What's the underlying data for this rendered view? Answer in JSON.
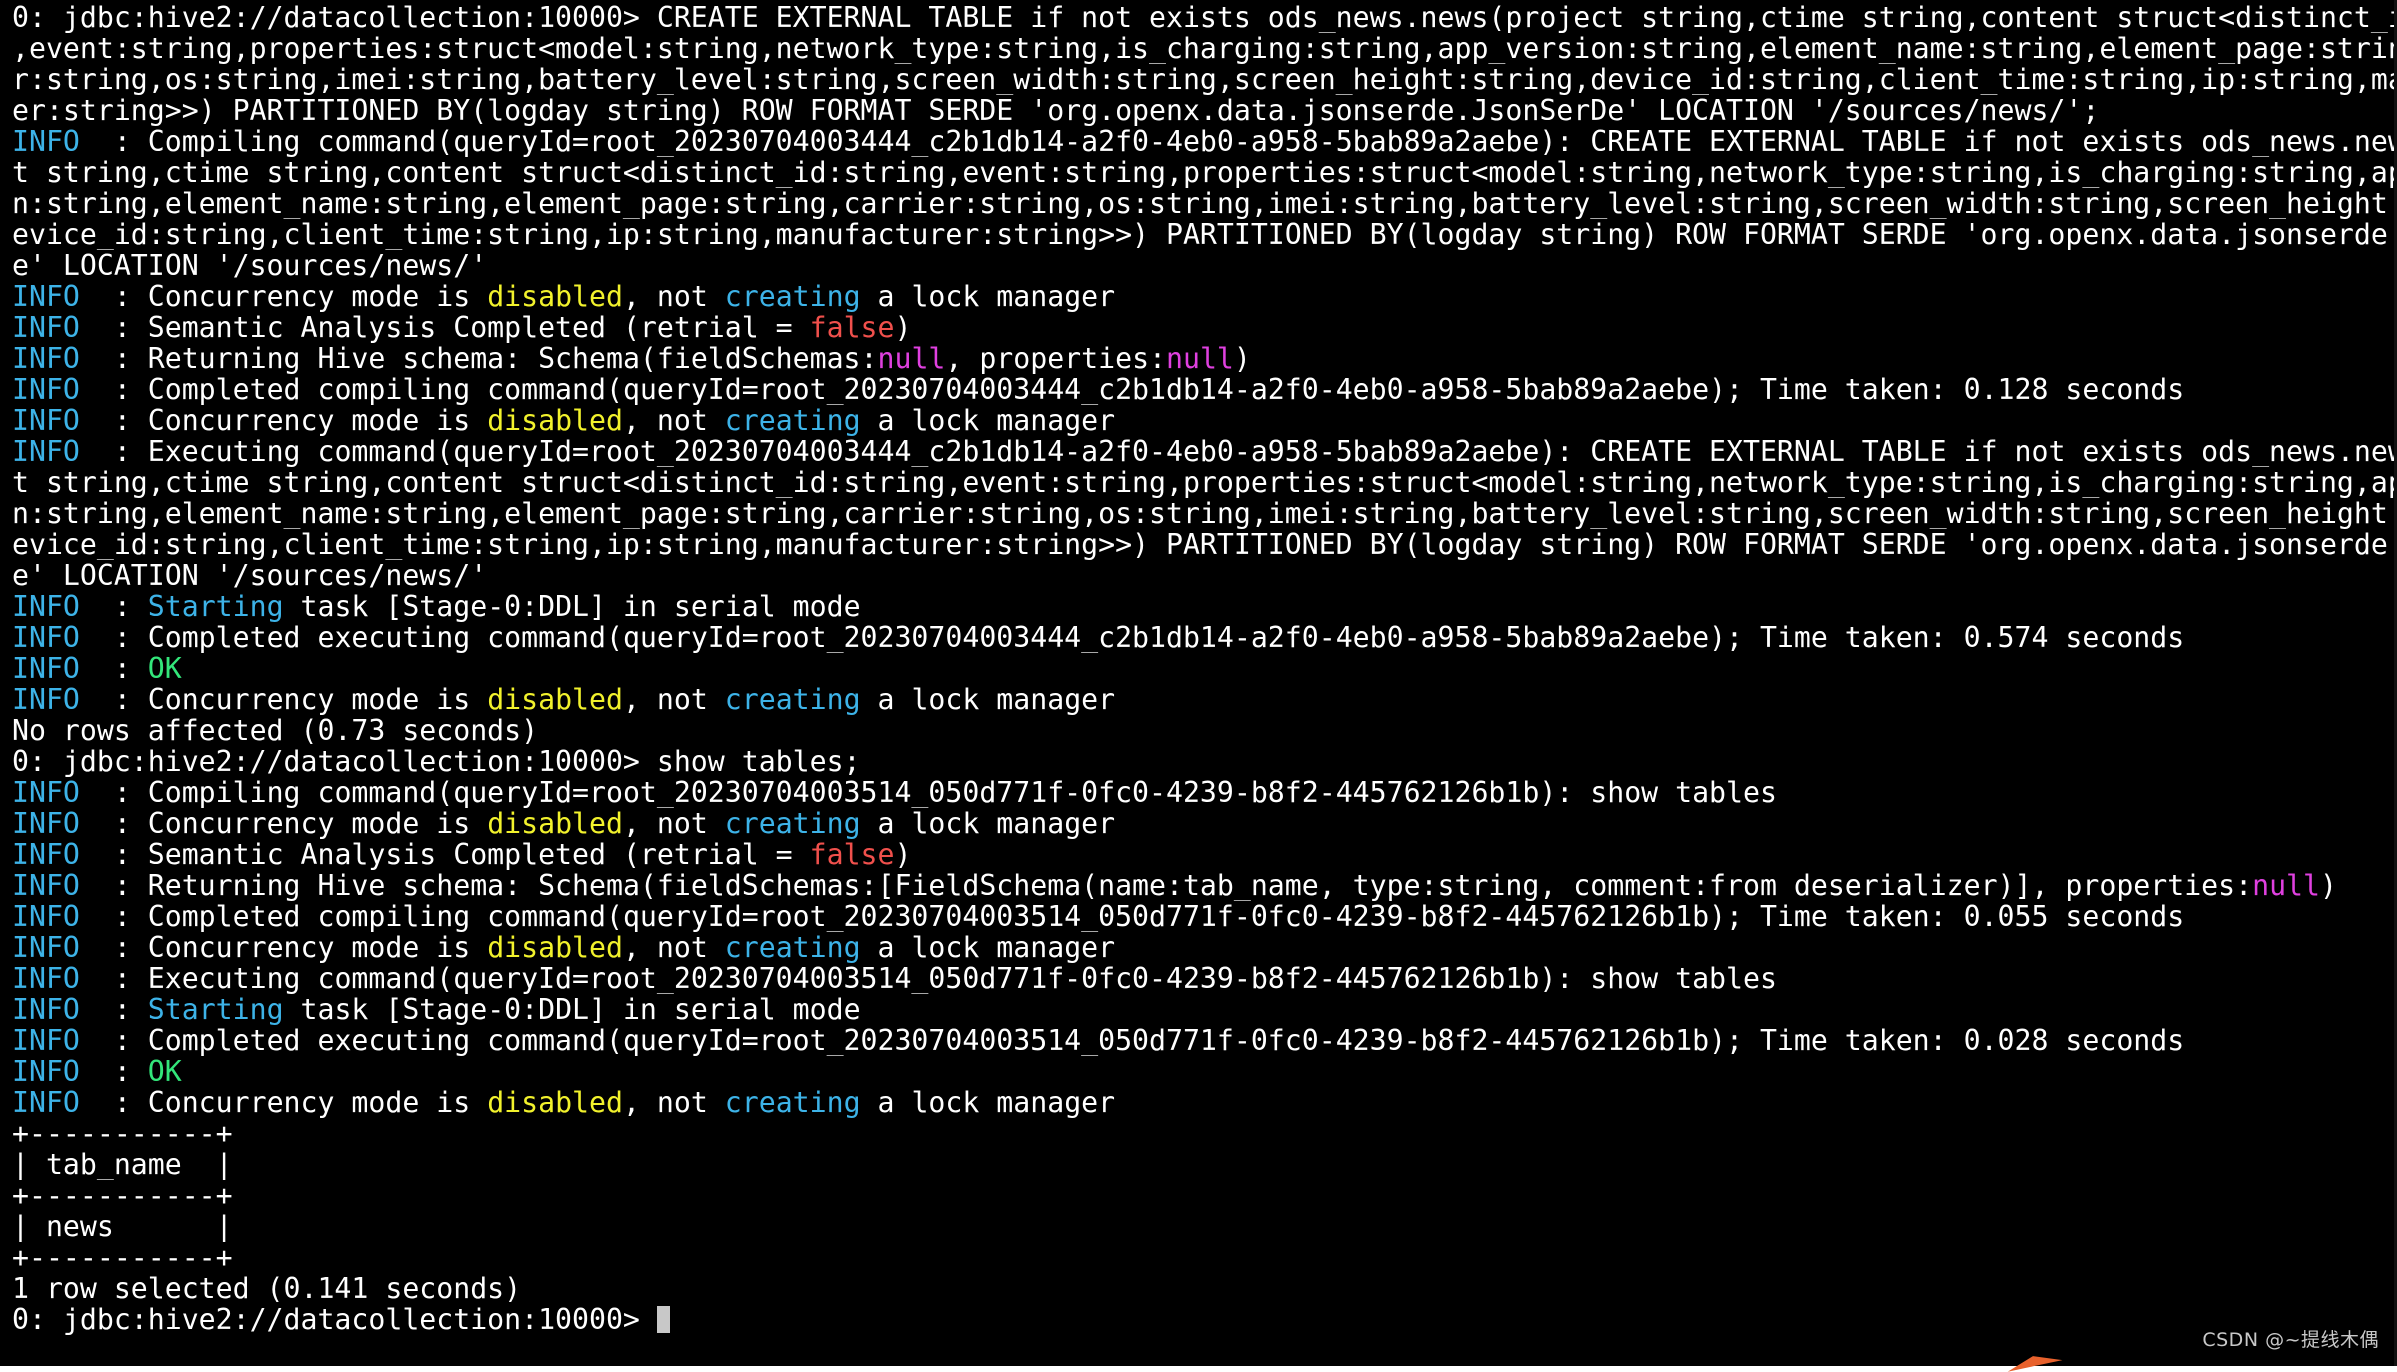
{
  "terminal": {
    "colors": {
      "background": "#000000",
      "text": "#ffffff",
      "info_blue": "#3db3e8",
      "disabled_yellow": "#f2f22c",
      "false_red": "#f0504c",
      "null_magenta": "#e040e0",
      "ok_green": "#33e67a"
    },
    "lines": [
      [
        {
          "t": "0: jdbc:hive2://datacollection:10000> CREATE EXTERNAL TABLE if not exists ods_news.news(project string,ctime string,content struct<distinct_id:string",
          "c": "default"
        }
      ],
      [
        {
          "t": ",event:string,properties:struct<model:string,network_type:string,is_charging:string,app_version:string,element_name:string,element_page:string,carrie",
          "c": "default"
        }
      ],
      [
        {
          "t": "r:string,os:string,imei:string,battery_level:string,screen_width:string,screen_height:string,device_id:string,client_time:string,ip:string,manufactur",
          "c": "default"
        }
      ],
      [
        {
          "t": "er:string>>) PARTITIONED BY(logday string) ROW FORMAT SERDE 'org.openx.data.jsonserde.JsonSerDe' LOCATION '/sources/news/';",
          "c": "default"
        }
      ],
      [
        {
          "t": "INFO",
          "c": "info"
        },
        {
          "t": "  : Compiling command(queryId=root_20230704003444_c2b1db14-a2f0-4eb0-a958-5bab89a2aebe): CREATE EXTERNAL TABLE if not exists ods_news.news(projec",
          "c": "default"
        }
      ],
      [
        {
          "t": "t string,ctime string,content struct<distinct_id:string,event:string,properties:struct<model:string,network_type:string,is_charging:string,app_versio",
          "c": "default"
        }
      ],
      [
        {
          "t": "n:string,element_name:string,element_page:string,carrier:string,os:string,imei:string,battery_level:string,screen_width:string,screen_height:string,d",
          "c": "default"
        }
      ],
      [
        {
          "t": "evice_id:string,client_time:string,ip:string,manufacturer:string>>) PARTITIONED BY(logday string) ROW FORMAT SERDE 'org.openx.data.jsonserde.JsonSerD",
          "c": "default"
        }
      ],
      [
        {
          "t": "e' LOCATION '/sources/news/'",
          "c": "default"
        }
      ],
      [
        {
          "t": "INFO",
          "c": "info"
        },
        {
          "t": "  : Concurrency mode is ",
          "c": "default"
        },
        {
          "t": "disabled",
          "c": "yellow"
        },
        {
          "t": ", not ",
          "c": "default"
        },
        {
          "t": "creating",
          "c": "cyan"
        },
        {
          "t": " a lock manager",
          "c": "default"
        }
      ],
      [
        {
          "t": "INFO",
          "c": "info"
        },
        {
          "t": "  : Semantic Analysis Completed (retrial = ",
          "c": "default"
        },
        {
          "t": "false",
          "c": "red"
        },
        {
          "t": ")",
          "c": "default"
        }
      ],
      [
        {
          "t": "INFO",
          "c": "info"
        },
        {
          "t": "  : Returning Hive schema: Schema(fieldSchemas:",
          "c": "default"
        },
        {
          "t": "null",
          "c": "magenta"
        },
        {
          "t": ", properties:",
          "c": "default"
        },
        {
          "t": "null",
          "c": "magenta"
        },
        {
          "t": ")",
          "c": "default"
        }
      ],
      [
        {
          "t": "INFO",
          "c": "info"
        },
        {
          "t": "  : Completed compiling command(queryId=root_20230704003444_c2b1db14-a2f0-4eb0-a958-5bab89a2aebe); Time taken: 0.128 seconds",
          "c": "default"
        }
      ],
      [
        {
          "t": "INFO",
          "c": "info"
        },
        {
          "t": "  : Concurrency mode is ",
          "c": "default"
        },
        {
          "t": "disabled",
          "c": "yellow"
        },
        {
          "t": ", not ",
          "c": "default"
        },
        {
          "t": "creating",
          "c": "cyan"
        },
        {
          "t": " a lock manager",
          "c": "default"
        }
      ],
      [
        {
          "t": "INFO",
          "c": "info"
        },
        {
          "t": "  : Executing command(queryId=root_20230704003444_c2b1db14-a2f0-4eb0-a958-5bab89a2aebe): CREATE EXTERNAL TABLE if not exists ods_news.news(projec",
          "c": "default"
        }
      ],
      [
        {
          "t": "t string,ctime string,content struct<distinct_id:string,event:string,properties:struct<model:string,network_type:string,is_charging:string,app_versio",
          "c": "default"
        }
      ],
      [
        {
          "t": "n:string,element_name:string,element_page:string,carrier:string,os:string,imei:string,battery_level:string,screen_width:string,screen_height:string,d",
          "c": "default"
        }
      ],
      [
        {
          "t": "evice_id:string,client_time:string,ip:string,manufacturer:string>>) PARTITIONED BY(logday string) ROW FORMAT SERDE 'org.openx.data.jsonserde.JsonSerD",
          "c": "default"
        }
      ],
      [
        {
          "t": "e' LOCATION '/sources/news/'",
          "c": "default"
        }
      ],
      [
        {
          "t": "INFO",
          "c": "info"
        },
        {
          "t": "  : ",
          "c": "default"
        },
        {
          "t": "Starting",
          "c": "cyan"
        },
        {
          "t": " task [Stage-0:DDL] in serial mode",
          "c": "default"
        }
      ],
      [
        {
          "t": "INFO",
          "c": "info"
        },
        {
          "t": "  : Completed executing command(queryId=root_20230704003444_c2b1db14-a2f0-4eb0-a958-5bab89a2aebe); Time taken: 0.574 seconds",
          "c": "default"
        }
      ],
      [
        {
          "t": "INFO",
          "c": "info"
        },
        {
          "t": "  : ",
          "c": "default"
        },
        {
          "t": "OK",
          "c": "green"
        }
      ],
      [
        {
          "t": "INFO",
          "c": "info"
        },
        {
          "t": "  : Concurrency mode is ",
          "c": "default"
        },
        {
          "t": "disabled",
          "c": "yellow"
        },
        {
          "t": ", not ",
          "c": "default"
        },
        {
          "t": "creating",
          "c": "cyan"
        },
        {
          "t": " a lock manager",
          "c": "default"
        }
      ],
      [
        {
          "t": "No rows affected (0.73 seconds)",
          "c": "default"
        }
      ],
      [
        {
          "t": "0: jdbc:hive2://datacollection:10000> show tables;",
          "c": "default"
        }
      ],
      [
        {
          "t": "INFO",
          "c": "info"
        },
        {
          "t": "  : Compiling command(queryId=root_20230704003514_050d771f-0fc0-4239-b8f2-445762126b1b): show tables",
          "c": "default"
        }
      ],
      [
        {
          "t": "INFO",
          "c": "info"
        },
        {
          "t": "  : Concurrency mode is ",
          "c": "default"
        },
        {
          "t": "disabled",
          "c": "yellow"
        },
        {
          "t": ", not ",
          "c": "default"
        },
        {
          "t": "creating",
          "c": "cyan"
        },
        {
          "t": " a lock manager",
          "c": "default"
        }
      ],
      [
        {
          "t": "INFO",
          "c": "info"
        },
        {
          "t": "  : Semantic Analysis Completed (retrial = ",
          "c": "default"
        },
        {
          "t": "false",
          "c": "red"
        },
        {
          "t": ")",
          "c": "default"
        }
      ],
      [
        {
          "t": "INFO",
          "c": "info"
        },
        {
          "t": "  : Returning Hive schema: Schema(fieldSchemas:[FieldSchema(name:tab_name, type:string, comment:from deserializer)], properties:",
          "c": "default"
        },
        {
          "t": "null",
          "c": "magenta"
        },
        {
          "t": ")",
          "c": "default"
        }
      ],
      [
        {
          "t": "INFO",
          "c": "info"
        },
        {
          "t": "  : Completed compiling command(queryId=root_20230704003514_050d771f-0fc0-4239-b8f2-445762126b1b); Time taken: 0.055 seconds",
          "c": "default"
        }
      ],
      [
        {
          "t": "INFO",
          "c": "info"
        },
        {
          "t": "  : Concurrency mode is ",
          "c": "default"
        },
        {
          "t": "disabled",
          "c": "yellow"
        },
        {
          "t": ", not ",
          "c": "default"
        },
        {
          "t": "creating",
          "c": "cyan"
        },
        {
          "t": " a lock manager",
          "c": "default"
        }
      ],
      [
        {
          "t": "INFO",
          "c": "info"
        },
        {
          "t": "  : Executing command(queryId=root_20230704003514_050d771f-0fc0-4239-b8f2-445762126b1b): show tables",
          "c": "default"
        }
      ],
      [
        {
          "t": "INFO",
          "c": "info"
        },
        {
          "t": "  : ",
          "c": "default"
        },
        {
          "t": "Starting",
          "c": "cyan"
        },
        {
          "t": " task [Stage-0:DDL] in serial mode",
          "c": "default"
        }
      ],
      [
        {
          "t": "INFO",
          "c": "info"
        },
        {
          "t": "  : Completed executing command(queryId=root_20230704003514_050d771f-0fc0-4239-b8f2-445762126b1b); Time taken: 0.028 seconds",
          "c": "default"
        }
      ],
      [
        {
          "t": "INFO",
          "c": "info"
        },
        {
          "t": "  : ",
          "c": "default"
        },
        {
          "t": "OK",
          "c": "green"
        }
      ],
      [
        {
          "t": "INFO",
          "c": "info"
        },
        {
          "t": "  : Concurrency mode is ",
          "c": "default"
        },
        {
          "t": "disabled",
          "c": "yellow"
        },
        {
          "t": ", not ",
          "c": "default"
        },
        {
          "t": "creating",
          "c": "cyan"
        },
        {
          "t": " a lock manager",
          "c": "default"
        }
      ],
      [
        {
          "t": "+-----------+",
          "c": "default"
        }
      ],
      [
        {
          "t": "| tab_name  |",
          "c": "default"
        }
      ],
      [
        {
          "t": "+-----------+",
          "c": "default"
        }
      ],
      [
        {
          "t": "| news      |",
          "c": "default"
        }
      ],
      [
        {
          "t": "+-----------+",
          "c": "default"
        }
      ],
      [
        {
          "t": "1 row selected (0.141 seconds)",
          "c": "default"
        }
      ]
    ],
    "prompt": "0: jdbc:hive2://datacollection:10000> "
  },
  "watermark": "CSDN @~提线木偶"
}
